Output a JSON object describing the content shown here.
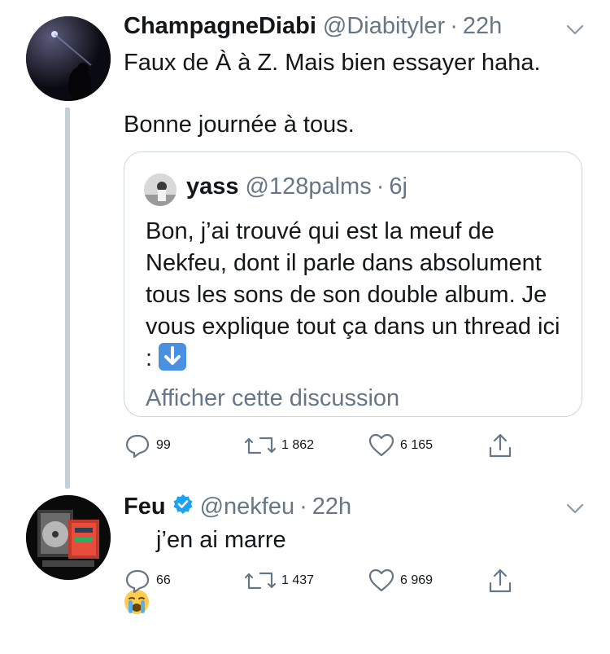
{
  "thread": [
    {
      "name": "ChampagneDiabi",
      "handle": "@Diabityler",
      "separator": "·",
      "time": "22h",
      "text": "Faux de À à Z. Mais bien essayer haha.\n\nBonne journée à tous.",
      "quoted": {
        "name": "yass",
        "handle": "@128palms",
        "separator": "·",
        "time": "6j",
        "text": "Bon, j’ai trouvé qui est la meuf de Nekfeu, dont il parle dans absolument tous les sons de son double album. Je vous explique tout ça dans un thread ici : ",
        "emoji": "down-arrow-emoji",
        "link": "Afficher cette discussion"
      },
      "actions": {
        "replies": "99",
        "retweets": "1 862",
        "likes": "6 165"
      }
    },
    {
      "name": "Feu",
      "verified": true,
      "handle": "@nekfeu",
      "separator": "·",
      "time": "22h",
      "emoji": "crying-face-emoji",
      "text": " j’en ai marre",
      "actions": {
        "replies": "66",
        "retweets": "1 437",
        "likes": "6 969"
      }
    }
  ],
  "colors": {
    "text": "#14171a",
    "secondary": "#657786",
    "border": "#ccd6dd",
    "thread_line": "#c4cfd6",
    "verified": "#1da1f2"
  }
}
